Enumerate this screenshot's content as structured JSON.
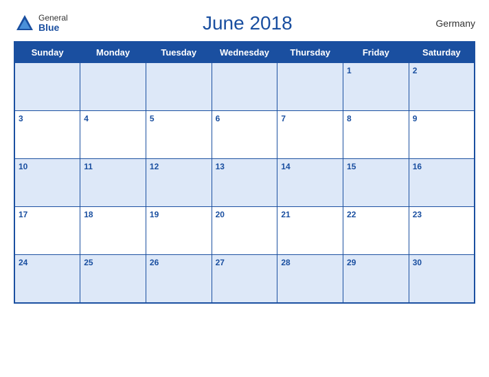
{
  "header": {
    "logo_general": "General",
    "logo_blue": "Blue",
    "title": "June 2018",
    "country": "Germany"
  },
  "days_of_week": [
    "Sunday",
    "Monday",
    "Tuesday",
    "Wednesday",
    "Thursday",
    "Friday",
    "Saturday"
  ],
  "weeks": [
    [
      null,
      null,
      null,
      null,
      null,
      1,
      2
    ],
    [
      3,
      4,
      5,
      6,
      7,
      8,
      9
    ],
    [
      10,
      11,
      12,
      13,
      14,
      15,
      16
    ],
    [
      17,
      18,
      19,
      20,
      21,
      22,
      23
    ],
    [
      24,
      25,
      26,
      27,
      28,
      29,
      30
    ]
  ]
}
